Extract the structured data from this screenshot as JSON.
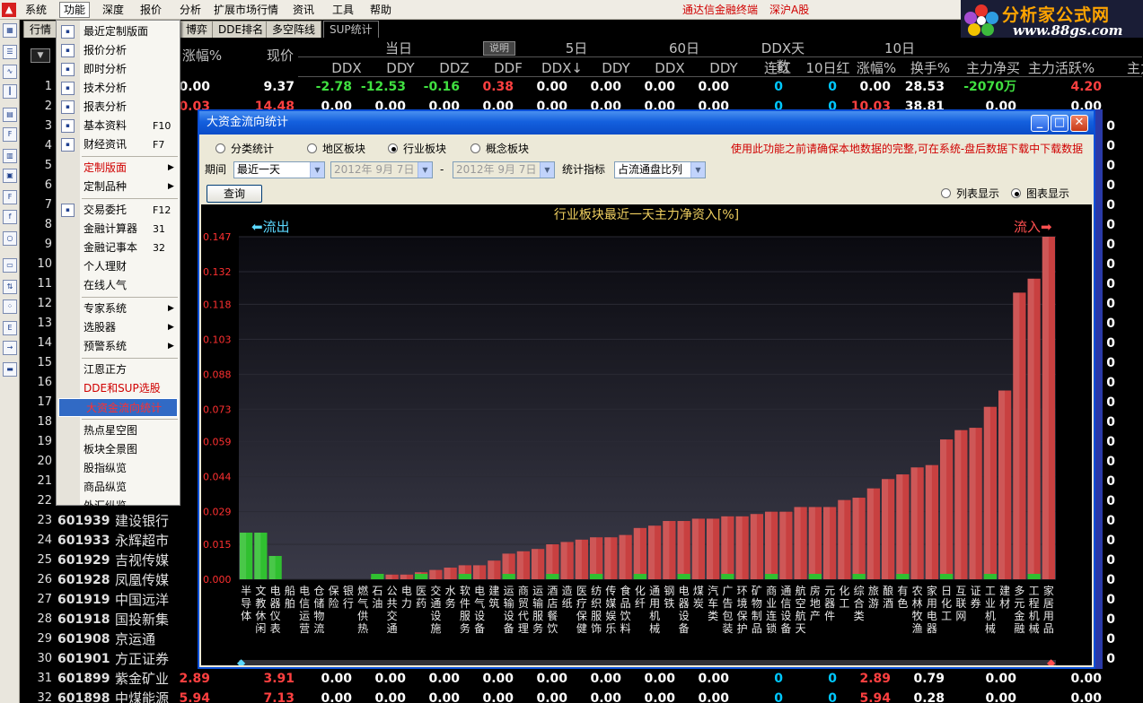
{
  "menubar": {
    "items": [
      "系统",
      "功能",
      "深度",
      "报价",
      "分析",
      "扩展市场行情",
      "资讯",
      "工具",
      "帮助"
    ],
    "promo": "通达信金融终端",
    "market": "深沪A股"
  },
  "logo": {
    "title": "分析家公式网",
    "url": "www.88gs.com"
  },
  "tabs": [
    "行情报价",
    "博弈",
    "DDE排名",
    "多空阵线",
    "SUP统计"
  ],
  "columns": {
    "top": [
      "当日",
      "说明",
      "5日",
      "60日",
      "DDX天数",
      "10日"
    ],
    "bottom": [
      "DDX",
      "DDY",
      "DDZ",
      "DDF",
      "DDX↓",
      "DDY",
      "DDX",
      "DDY",
      "连红",
      "10日红",
      "涨幅%",
      "换手%",
      "主力净买",
      "主力活跃%",
      "主力"
    ],
    "left": [
      "涨幅%",
      "现价"
    ],
    "sort_arrow": "▼"
  },
  "rows": [
    {
      "n": "1",
      "code": "",
      "name": "",
      "v": [
        "0.00",
        "9.37",
        "-2.78",
        "-12.53",
        "-0.16",
        "0.38",
        "0.00",
        "0.00",
        "0.00",
        "0.00",
        "0",
        "0",
        "0.00",
        "28.53",
        "-2070万",
        "4.20"
      ]
    },
    {
      "n": "2",
      "code": "",
      "name": "",
      "v": [
        "10.03",
        "14.48",
        "0.00",
        "0.00",
        "0.00",
        "0.00",
        "0.00",
        "0.00",
        "0.00",
        "0.00",
        "0",
        "0",
        "10.03",
        "38.81",
        "0.00",
        "0.00"
      ]
    },
    {
      "n": "3",
      "code": "",
      "name": "",
      "v": []
    },
    {
      "n": "4",
      "code": "",
      "name": "",
      "v": []
    },
    {
      "n": "5",
      "code": "",
      "name": "",
      "v": []
    },
    {
      "n": "6",
      "code": "",
      "name": "",
      "v": []
    },
    {
      "n": "7",
      "code": "",
      "name": "",
      "v": []
    },
    {
      "n": "8",
      "code": "",
      "name": "",
      "v": []
    },
    {
      "n": "9",
      "code": "",
      "name": "",
      "v": []
    },
    {
      "n": "10",
      "code": "",
      "name": "",
      "v": []
    },
    {
      "n": "11",
      "code": "",
      "name": "",
      "v": []
    },
    {
      "n": "12",
      "code": "",
      "name": "",
      "v": []
    },
    {
      "n": "13",
      "code": "",
      "name": "",
      "v": []
    },
    {
      "n": "14",
      "code": "",
      "name": "",
      "v": []
    },
    {
      "n": "15",
      "code": "",
      "name": "",
      "v": []
    },
    {
      "n": "16",
      "code": "",
      "name": "",
      "v": []
    },
    {
      "n": "17",
      "code": "",
      "name": "",
      "v": []
    },
    {
      "n": "18",
      "code": "",
      "name": "",
      "v": []
    },
    {
      "n": "19",
      "code": "",
      "name": "",
      "v": []
    },
    {
      "n": "20",
      "code": "",
      "name": "",
      "v": []
    },
    {
      "n": "21",
      "code": "",
      "name": "",
      "v": []
    },
    {
      "n": "22",
      "code": "",
      "name": "",
      "v": []
    },
    {
      "n": "23",
      "code": "601939",
      "name": "建设银行",
      "v": []
    },
    {
      "n": "24",
      "code": "601933",
      "name": "永辉超市",
      "v": []
    },
    {
      "n": "25",
      "code": "601929",
      "name": "吉视传媒",
      "v": []
    },
    {
      "n": "26",
      "code": "601928",
      "name": "凤凰传媒",
      "v": []
    },
    {
      "n": "27",
      "code": "601919",
      "name": "中国远洋",
      "v": []
    },
    {
      "n": "28",
      "code": "601918",
      "name": "国投新集",
      "v": []
    },
    {
      "n": "29",
      "code": "601908",
      "name": "京运通",
      "v": []
    },
    {
      "n": "30",
      "code": "601901",
      "name": "方正证券",
      "v": []
    },
    {
      "n": "31",
      "code": "601899",
      "name": "紫金矿业",
      "v": [
        "2.89",
        "3.91",
        "0.00",
        "0.00",
        "0.00",
        "0.00",
        "0.00",
        "0.00",
        "0.00",
        "0.00",
        "0",
        "0",
        "2.89",
        "0.79",
        "0.00",
        "0.00"
      ]
    },
    {
      "n": "32",
      "code": "601898",
      "name": "中煤能源",
      "v": [
        "5.94",
        "7.13",
        "0.00",
        "0.00",
        "0.00",
        "0.00",
        "0.00",
        "0.00",
        "0.00",
        "0.00",
        "0",
        "0",
        "5.94",
        "0.28",
        "0.00",
        "0.00"
      ]
    }
  ],
  "dropdown": [
    {
      "label": "最近定制版面",
      "key": "",
      "sub": false,
      "icon": "layout-icon"
    },
    {
      "label": "报价分析",
      "key": "",
      "sub": false,
      "icon": "table-icon"
    },
    {
      "label": "即时分析",
      "key": "",
      "sub": false,
      "icon": "line-chart-icon"
    },
    {
      "label": "技术分析",
      "key": "",
      "sub": false,
      "icon": "candlestick-icon"
    },
    {
      "label": "报表分析",
      "key": "",
      "sub": false,
      "icon": "report-icon"
    },
    {
      "label": "基本资料",
      "key": "F10",
      "sub": false,
      "icon": "f10-icon"
    },
    {
      "label": "财经资讯",
      "key": "F7",
      "sub": false,
      "icon": "news-icon"
    },
    {
      "sep": true
    },
    {
      "label": "定制版面",
      "key": "",
      "sub": true,
      "red": true
    },
    {
      "label": "定制品种",
      "key": "",
      "sub": true
    },
    {
      "sep": true
    },
    {
      "label": "交易委托",
      "key": "F12",
      "sub": false,
      "icon": "f12-icon"
    },
    {
      "label": "金融计算器",
      "key": "31",
      "sub": false
    },
    {
      "label": "金融记事本",
      "key": "32",
      "sub": false
    },
    {
      "label": "个人理财",
      "key": "",
      "sub": false
    },
    {
      "label": "在线人气",
      "key": "",
      "sub": false
    },
    {
      "sep": true
    },
    {
      "label": "专家系统",
      "key": "",
      "sub": true
    },
    {
      "label": "选股器",
      "key": "",
      "sub": true
    },
    {
      "label": "预警系统",
      "key": "",
      "sub": true
    },
    {
      "sep": true
    },
    {
      "label": "江恩正方",
      "key": "",
      "sub": false
    },
    {
      "label": "DDE和SUP选股",
      "key": "",
      "sub": false,
      "red": true
    },
    {
      "label": "大资金流向统计",
      "key": "",
      "sub": false,
      "highlight": true
    },
    {
      "sep": true
    },
    {
      "label": "热点星空图",
      "key": "",
      "sub": false
    },
    {
      "label": "板块全景图",
      "key": "",
      "sub": false
    },
    {
      "label": "股指纵览",
      "key": "",
      "sub": false
    },
    {
      "label": "商品纵览",
      "key": "",
      "sub": false
    },
    {
      "label": "外汇纵览",
      "key": "",
      "sub": false
    }
  ],
  "dialog": {
    "title": "大资金流向统计",
    "radios": [
      {
        "label": "分类统计",
        "checked": false
      },
      {
        "label": "地区板块",
        "checked": false
      },
      {
        "label": "行业板块",
        "checked": true
      },
      {
        "label": "概念板块",
        "checked": false
      }
    ],
    "warning": "使用此功能之前请确保本地数据的完整,可在系统-盘后数据下载中下载数据",
    "period_label": "期间",
    "period_value": "最近一天",
    "date_from": "2012年 9月 7日",
    "date_to": "2012年 9月 7日",
    "date_sep": "-",
    "metric_label": "统计指标",
    "metric_value": "占流通盘比列",
    "query_button": "查询",
    "view_options": [
      {
        "label": "列表显示",
        "checked": false
      },
      {
        "label": "图表显示",
        "checked": true
      }
    ],
    "outflow_label": "流出",
    "inflow_label": "流入"
  },
  "colors": {
    "bar_red": "#c84040",
    "bar_green": "#30c030",
    "accent_title": "#0a4fd8"
  },
  "chart_data": {
    "type": "bar",
    "title": "行业板块最近一天主力净资入[%]",
    "ylim": [
      0,
      0.147
    ],
    "yticks": [
      "0.000",
      "0.015",
      "0.029",
      "0.044",
      "0.059",
      "0.073",
      "0.088",
      "0.103",
      "0.118",
      "0.132",
      "0.147"
    ],
    "categories": [
      "半导体",
      "文教休闲",
      "电器仪表",
      "船舶",
      "电信运营",
      "仓储物流",
      "保险",
      "银行",
      "燃气供热",
      "石油",
      "公共交通",
      "电力",
      "医药",
      "交通设施",
      "水务",
      "软件服务",
      "电气设备",
      "建筑",
      "运输设备",
      "商贸代理",
      "运输服务",
      "酒店餐饮",
      "造纸",
      "医疗保健",
      "纺织服饰",
      "传媒娱乐",
      "食品饮料",
      "化纤",
      "通用机械",
      "钢铁",
      "电器设备",
      "煤炭",
      "汽车类",
      "广告包装",
      "环境保护",
      "矿物制品",
      "商业连锁",
      "通信设备",
      "航空航天",
      "房地产",
      "元器件",
      "化工",
      "综合类",
      "旅游",
      "酿酒",
      "有色",
      "农林牧渔",
      "家用电器",
      "日化工",
      "互联网",
      "证券",
      "工业机械",
      "建材",
      "多元金融",
      "工程机械",
      "家居用品"
    ],
    "series": [
      {
        "values": [
          -0.02,
          -0.02,
          -0.01,
          0.0,
          0.0,
          0.0,
          0.0,
          0.0,
          0.0,
          0.001,
          0.002,
          0.002,
          0.003,
          0.004,
          0.005,
          0.006,
          0.006,
          0.008,
          0.011,
          0.012,
          0.013,
          0.015,
          0.016,
          0.017,
          0.018,
          0.018,
          0.019,
          0.022,
          0.023,
          0.025,
          0.025,
          0.026,
          0.026,
          0.027,
          0.027,
          0.028,
          0.029,
          0.029,
          0.031,
          0.031,
          0.031,
          0.034,
          0.035,
          0.039,
          0.043,
          0.045,
          0.048,
          0.049,
          0.06,
          0.064,
          0.065,
          0.074,
          0.081,
          0.123,
          0.129,
          0.147
        ]
      }
    ]
  }
}
